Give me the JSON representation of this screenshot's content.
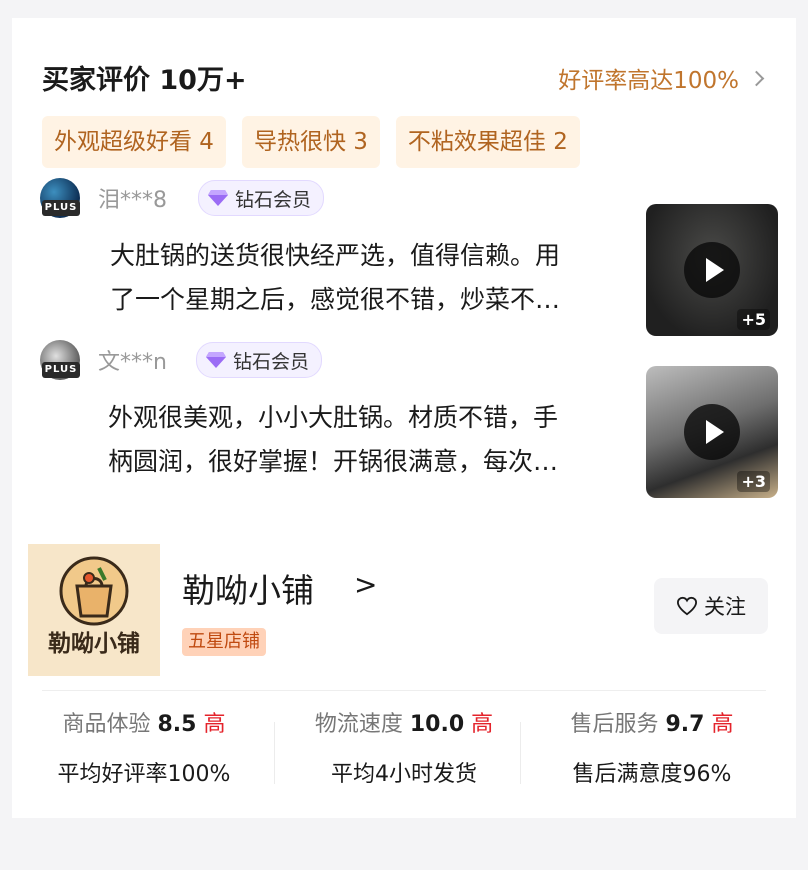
{
  "reviews_section": {
    "title": "买家评价 10万+",
    "rate_link": "好评率高达100%",
    "tags": [
      "外观超级好看 4",
      "导热很快 3",
      "不粘效果超佳 2"
    ],
    "items": [
      {
        "nickname": "泪***8",
        "badge": "钻石会员",
        "plus_label": "PLUS",
        "text_line1": "大肚锅的送货很快经严选，值得信赖。用",
        "text_line2": "了一个星期之后，感觉很不错，炒菜不…",
        "media_count": "+5"
      },
      {
        "nickname": "文***n",
        "badge": "钻石会员",
        "plus_label": "PLUS",
        "text_line1": "外观很美观，小小大肚锅。材质不错，手",
        "text_line2": "柄圆润，很好掌握！开锅很满意，每次…",
        "media_count": "+3"
      }
    ]
  },
  "shop": {
    "logo_text": "勒呦小铺",
    "name": "勒呦小铺",
    "arrow": ">",
    "rating_badge": "五星店铺",
    "follow_label": "关注",
    "stats": [
      {
        "label": "商品体验",
        "score": "8.5",
        "level": "高",
        "detail": "平均好评率100%"
      },
      {
        "label": "物流速度",
        "score": "10.0",
        "level": "高",
        "detail": "平均4小时发货"
      },
      {
        "label": "售后服务",
        "score": "9.7",
        "level": "高",
        "detail": "售后满意度96%"
      }
    ]
  },
  "colors": {
    "accent": "#c0752d",
    "tag_bg": "#fff3e4",
    "high": "#e4232b",
    "badge_bg": "#ffd2b8"
  }
}
